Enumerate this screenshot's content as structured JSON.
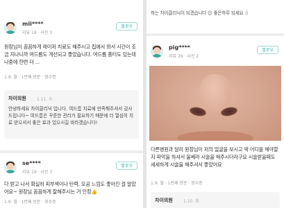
{
  "left_column": {
    "review1": {
      "username": "mii****",
      "meta": "리뷰 19 · 사진 3",
      "follow_label": "팔로우",
      "text": "원장님이 꼼꼼하게 레이저 치료도 해주시고 집에서 와서 시간이 조금 지나니까 여드름도 개선되고 좋았습니다. 여드름 흉터도 있는데 나중에 한번 더 ...",
      "date": "1.9. 월 · 1번째 방문 · 영수증",
      "reply": {
        "name": "차이의원",
        "date": "1.11. 수",
        "text": "안녕하세요 차이클리닉 입니다. 여드름 치료에 만족해주셔서 감사드립니다~ 여드름은 꾸준한 관리가 필요하기 때문에 더 열심히 치료 받으셔서 좋은 효과 있으시길 바라겠습니다!"
      }
    },
    "review2": {
      "username": "se****",
      "meta": "리뷰 19 · 사진 3",
      "follow_label": "팔로우",
      "text": "다 받고 나서 확실히 피부색이나 탄력, 모공 느낌도 좋아진 걸 알았어요~ 원장님 꼼꼼하게 잘해주시는 거 인정👍",
      "date": "1.9. 월 · 1번째 방문 · 영수증"
    }
  },
  "right_column": {
    "top_fragment": "하는 차이클리닉이 되겠습니다 😊 좋은하루 되세요 :)",
    "review3": {
      "username": "pig****",
      "meta": "리뷰 26 · 사진 2",
      "follow_label": "팔로우",
      "text": "다른병원과 달리 원장님이 저의 얼굴을 보시고 딱 어디를 해야할지 파악을 하셔서 울쎄라 시술을 해주시더라구요 시술받을때도 세세하게 시술을 해주셔서 좋았어요",
      "date": "1.9. 월 · 1번째 방문 · 영수증",
      "reply": {
        "name": "차이의원",
        "date": "1.10. 화"
      }
    }
  },
  "colors": {
    "accent": "#2bb3a3",
    "background": "#e4e4e4"
  }
}
